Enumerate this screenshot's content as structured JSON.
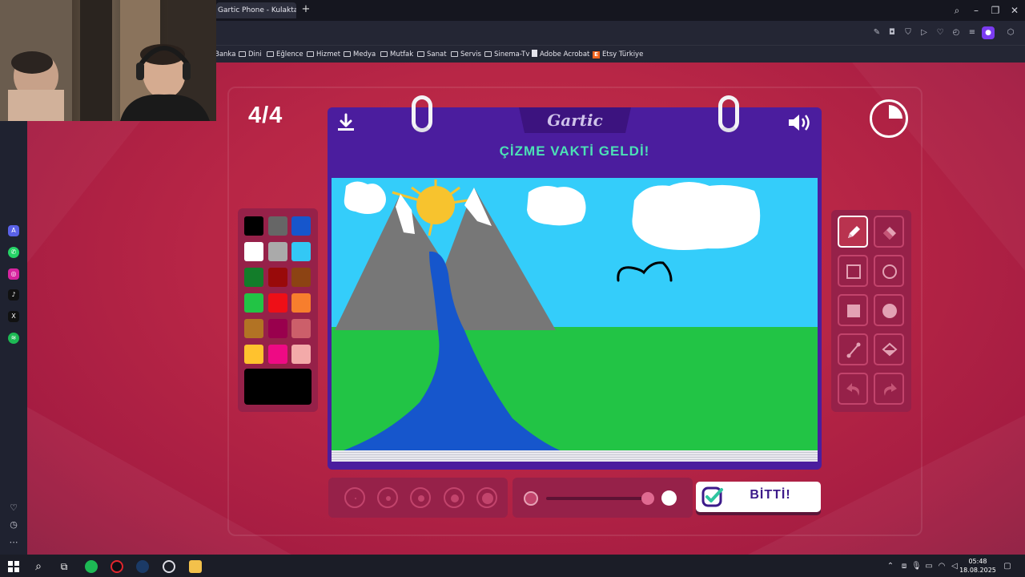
{
  "browser": {
    "tab_title": "Gartic Phone - Kulaktan K",
    "new_tab_icon": "plus-icon",
    "window_controls": [
      "search-icon",
      "minimize-icon",
      "restore-icon",
      "close-icon"
    ]
  },
  "bookmarks": [
    {
      "label": "Banka",
      "icon": "folder-icon"
    },
    {
      "label": "Dini",
      "icon": "folder-icon"
    },
    {
      "label": "Eğlence",
      "icon": "folder-icon"
    },
    {
      "label": "Hizmet",
      "icon": "folder-icon"
    },
    {
      "label": "Medya",
      "icon": "folder-icon"
    },
    {
      "label": "Mutfak",
      "icon": "folder-icon"
    },
    {
      "label": "Sanat",
      "icon": "folder-icon"
    },
    {
      "label": "Servis",
      "icon": "folder-icon"
    },
    {
      "label": "Sinema-Tv",
      "icon": "folder-icon"
    },
    {
      "label": "Adobe Acrobat",
      "icon": "document-icon"
    },
    {
      "label": "Etsy Türkiye",
      "icon": "etsy-icon"
    }
  ],
  "game": {
    "round": "4/4",
    "logo": "Gartic",
    "prompt": "ÇİZME VAKTİ GELDİ!",
    "done_label": "BİTTİ!",
    "timer_elapsed_fraction": 0.25,
    "opacity_value_fraction": 0.98,
    "selected_brush_size_index": 1,
    "selected_tool": "pencil",
    "current_color": "#000000",
    "palette": [
      "#000000",
      "#666666",
      "#1656cc",
      "#ffffff",
      "#aaaaaa",
      "#33c8f5",
      "#137d2a",
      "#990a0a",
      "#8c4313",
      "#22c445",
      "#ee0f17",
      "#f77e2d",
      "#b27324",
      "#99004d",
      "#cc5f6a",
      "#ffc22e",
      "#ee0a84",
      "#f3aaa9"
    ],
    "tools": [
      "pencil",
      "eraser",
      "rectangle-outline",
      "ellipse-outline",
      "rectangle-filled",
      "ellipse-filled",
      "line",
      "fill-bucket",
      "undo",
      "redo"
    ]
  },
  "taskbar": {
    "clock_time": "05:48",
    "clock_date": "18.08.2025"
  }
}
